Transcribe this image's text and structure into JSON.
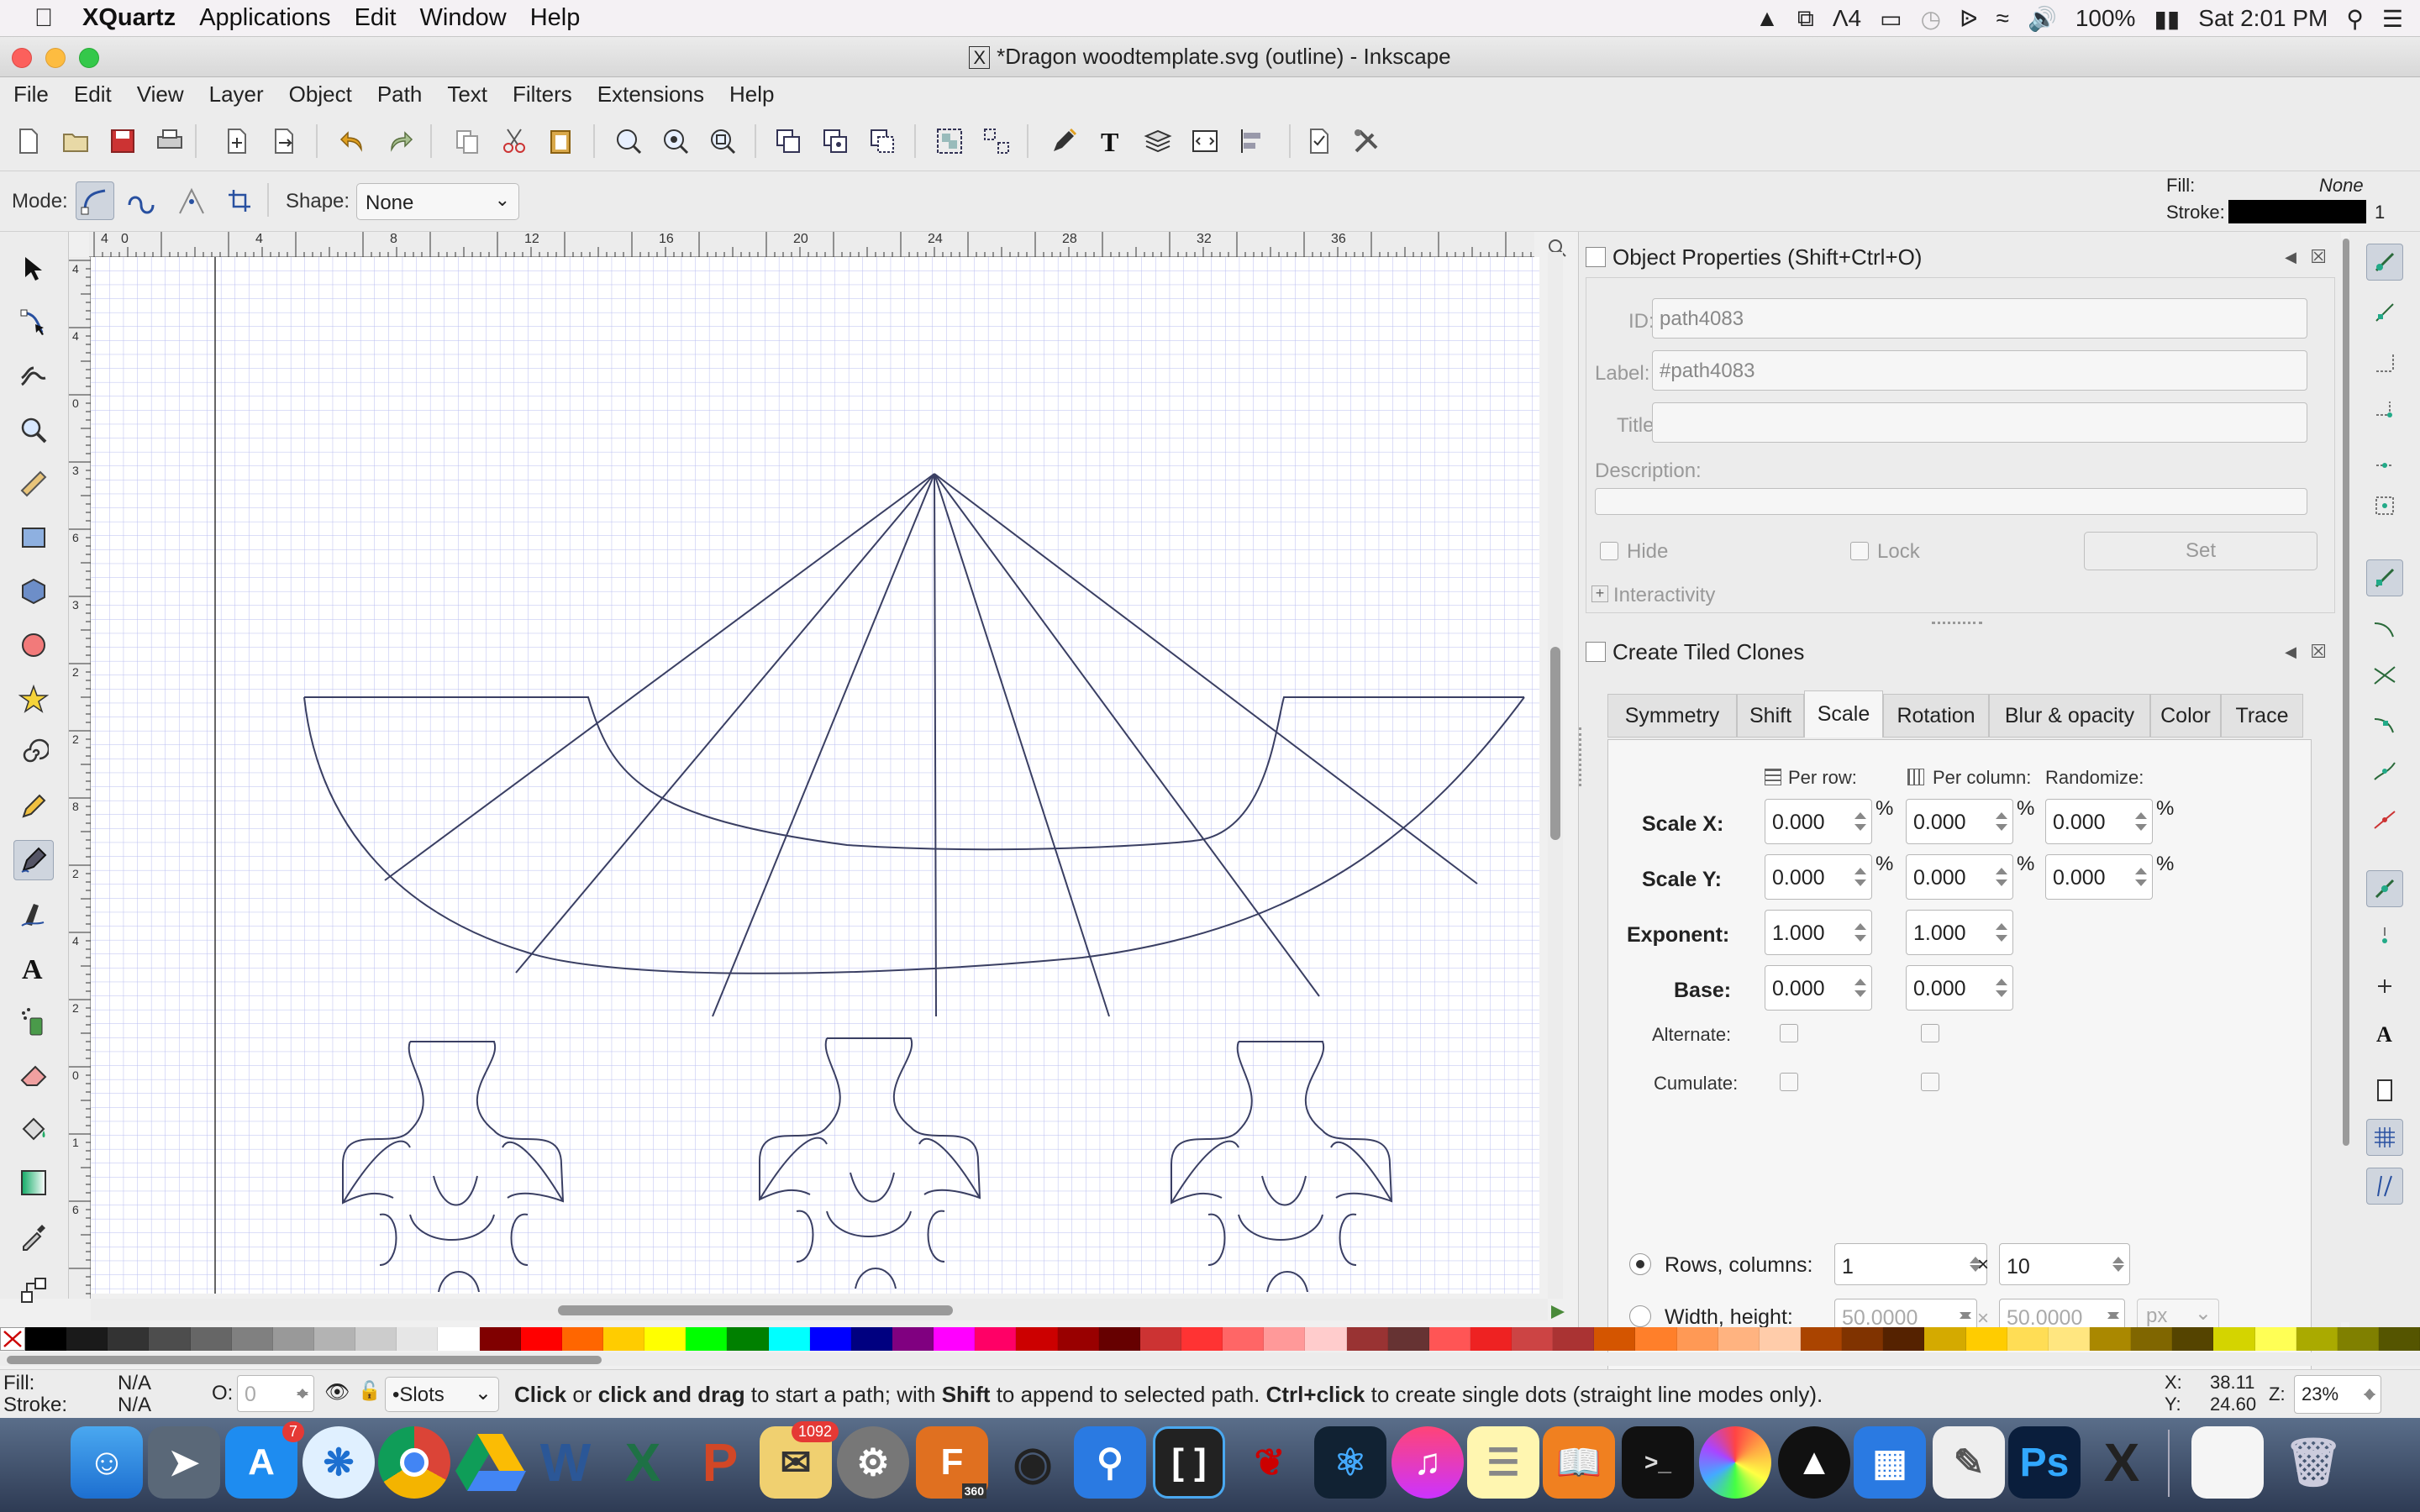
{
  "mac_menubar": {
    "app_name": "XQuartz",
    "items": [
      "Applications",
      "Edit",
      "Window",
      "Help"
    ],
    "status": {
      "notifications_count": "4",
      "battery": "100%",
      "clock": "Sat 2:01 PM"
    }
  },
  "window": {
    "title": "*Dragon woodtemplate.svg (outline) - Inkscape"
  },
  "menu": [
    "File",
    "Edit",
    "View",
    "Layer",
    "Object",
    "Path",
    "Text",
    "Filters",
    "Extensions",
    "Help"
  ],
  "tool_controls": {
    "mode_label": "Mode:",
    "shape_label": "Shape:",
    "shape_value": "None"
  },
  "style_indicator": {
    "fill_label": "Fill:",
    "fill_value": "None",
    "stroke_label": "Stroke:",
    "stroke_width": "1"
  },
  "rulers": {
    "h_ticks": [
      "4",
      "0",
      "4",
      "8",
      "12",
      "16",
      "20",
      "24",
      "28",
      "32",
      "36"
    ],
    "v_ticks": [
      "4",
      "4",
      "0",
      "3",
      "6",
      "3",
      "2",
      "2",
      "8",
      "2",
      "4",
      "2",
      "0",
      "1",
      "6"
    ]
  },
  "object_properties": {
    "title": "Object Properties (Shift+Ctrl+O)",
    "id_label": "ID:",
    "id_value": "path4083",
    "label_label": "Label:",
    "label_value": "#path4083",
    "title_label": "Title:",
    "title_value": "",
    "description_label": "Description:",
    "hide_label": "Hide",
    "lock_label": "Lock",
    "set_label": "Set",
    "interactivity_label": "Interactivity"
  },
  "tiled_clones": {
    "title": "Create Tiled Clones",
    "tabs": [
      "Symmetry",
      "Shift",
      "Scale",
      "Rotation",
      "Blur & opacity",
      "Color",
      "Trace"
    ],
    "active_tab": "Scale",
    "per_row_label": "Per row:",
    "per_column_label": "Per column:",
    "randomize_label": "Randomize:",
    "scale_x_label": "Scale X:",
    "scale_x": {
      "row": "0.000",
      "col": "0.000",
      "rand": "0.000"
    },
    "scale_y_label": "Scale Y:",
    "scale_y": {
      "row": "0.000",
      "col": "0.000",
      "rand": "0.000"
    },
    "exponent_label": "Exponent:",
    "exponent": {
      "row": "1.000",
      "col": "1.000"
    },
    "base_label": "Base:",
    "base": {
      "row": "0.000",
      "col": "0.000"
    },
    "percent": "%",
    "alternate_label": "Alternate:",
    "cumulate_label": "Cumulate:",
    "rows_columns_label": "Rows, columns:",
    "rows": "1",
    "columns": "10",
    "times": "×",
    "width_height_label": "Width, height:",
    "width": "50.0000",
    "height": "50.0000",
    "unit": "px"
  },
  "status": {
    "fill_label": "Fill:",
    "fill_value": "N/A",
    "stroke_label": "Stroke:",
    "stroke_value": "N/A",
    "opacity_label": "O:",
    "opacity_value": "0",
    "layer": "•Slots",
    "message_parts": [
      "Click",
      " or ",
      "click and drag",
      " to start a path; with ",
      "Shift",
      " to append to selected path. ",
      "Ctrl+click",
      " to create single dots (straight line modes only)."
    ],
    "x_label": "X:",
    "x_value": "38.11",
    "y_label": "Y:",
    "y_value": "24.60",
    "zoom_label": "Z:",
    "zoom_value": "23%"
  },
  "dock_badges": {
    "app_store": "7",
    "mail": "1092",
    "fusion": "360"
  },
  "palette_colors": [
    "#000000",
    "#1a1a1a",
    "#333333",
    "#4d4d4d",
    "#666666",
    "#808080",
    "#999999",
    "#b3b3b3",
    "#cccccc",
    "#e6e6e6",
    "#ffffff",
    "#800000",
    "#ff0000",
    "#ff6600",
    "#ffcc00",
    "#ffff00",
    "#00ff00",
    "#008000",
    "#00ffff",
    "#0000ff",
    "#000080",
    "#800080",
    "#ff00ff",
    "#ff0066",
    "#cc0000",
    "#990000",
    "#660000",
    "#cc3333",
    "#ff3333",
    "#ff6666",
    "#ff9999",
    "#ffcccc",
    "#993333",
    "#663333",
    "#ff5555",
    "#ee2222",
    "#cc4444",
    "#aa3333",
    "#d45500",
    "#ff7f2a",
    "#ff9955",
    "#ffb380",
    "#ffccaa",
    "#aa4400",
    "#803300",
    "#552200",
    "#d4aa00",
    "#ffcc00",
    "#ffdd55",
    "#ffe680",
    "#aa8800",
    "#806600",
    "#554400",
    "#d4d400",
    "#ffff55",
    "#aaaa00",
    "#808000",
    "#555500"
  ]
}
